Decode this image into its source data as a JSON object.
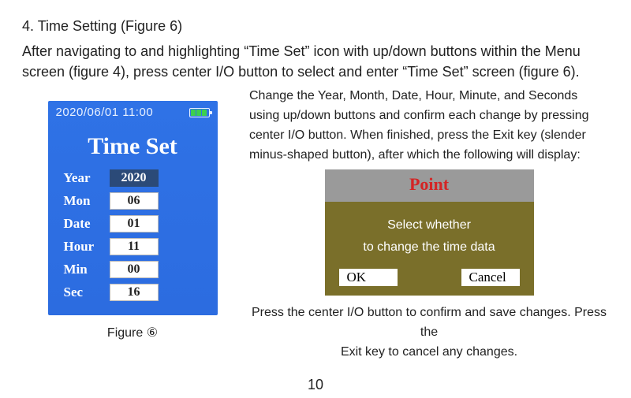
{
  "doc": {
    "heading": "4. Time Setting (Figure 6)",
    "intro": "After navigating to and highlighting “Time Set” icon with up/down buttons within the Menu screen (figure 4), press center I/O button to select and enter “Time Set” screen (figure 6).",
    "right_paragraph": "Change the Year, Month, Date, Hour, Minute, and Seconds using up/down buttons and confirm each change by pressing center I/O button. When finished, press the Exit key (slender minus-shaped button), after which the following will display:",
    "after_dialog_line1": "Press the center I/O button to confirm and save changes. Press the",
    "after_dialog_line2": "Exit key to cancel any changes.",
    "page_number": "10"
  },
  "device": {
    "datetime": "2020/06/01  11:00",
    "title": "Time Set",
    "rows": {
      "year": {
        "label": "Year",
        "value": "2020",
        "selected": true
      },
      "mon": {
        "label": "Mon",
        "value": "06",
        "selected": false
      },
      "date": {
        "label": "Date",
        "value": "01",
        "selected": false
      },
      "hour": {
        "label": "Hour",
        "value": "11",
        "selected": false
      },
      "min": {
        "label": "Min",
        "value": "00",
        "selected": false
      },
      "sec": {
        "label": "Sec",
        "value": "16",
        "selected": false
      }
    },
    "figure_caption": "Figure ⑥"
  },
  "dialog": {
    "title": "Point",
    "line1": "Select whether",
    "line2": "to change the time data",
    "ok": "OK",
    "cancel": "Cancel"
  }
}
